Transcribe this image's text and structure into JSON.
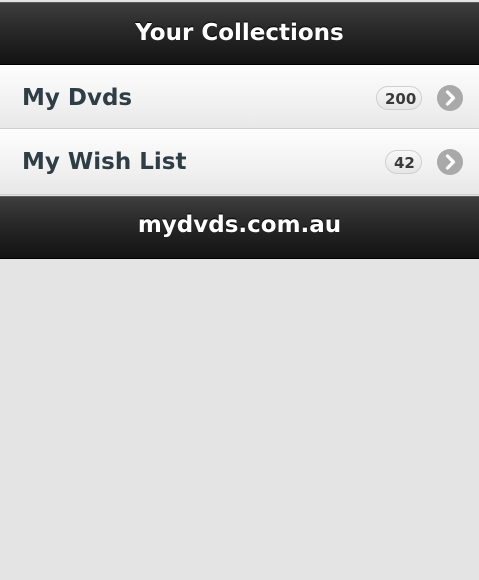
{
  "header": {
    "title": "Your Collections"
  },
  "collections": [
    {
      "label": "My Dvds",
      "count": "200"
    },
    {
      "label": "My Wish List",
      "count": "42"
    }
  ],
  "footer": {
    "text": "mydvds.com.au"
  },
  "icons": {
    "row_arrow": "chevron-right-circle-icon"
  },
  "colors": {
    "bar_background": "#1f1f1f",
    "page_background": "#e4e4e4",
    "item_text": "#2f3e46",
    "arrow_circle": "#a9a9a9"
  }
}
